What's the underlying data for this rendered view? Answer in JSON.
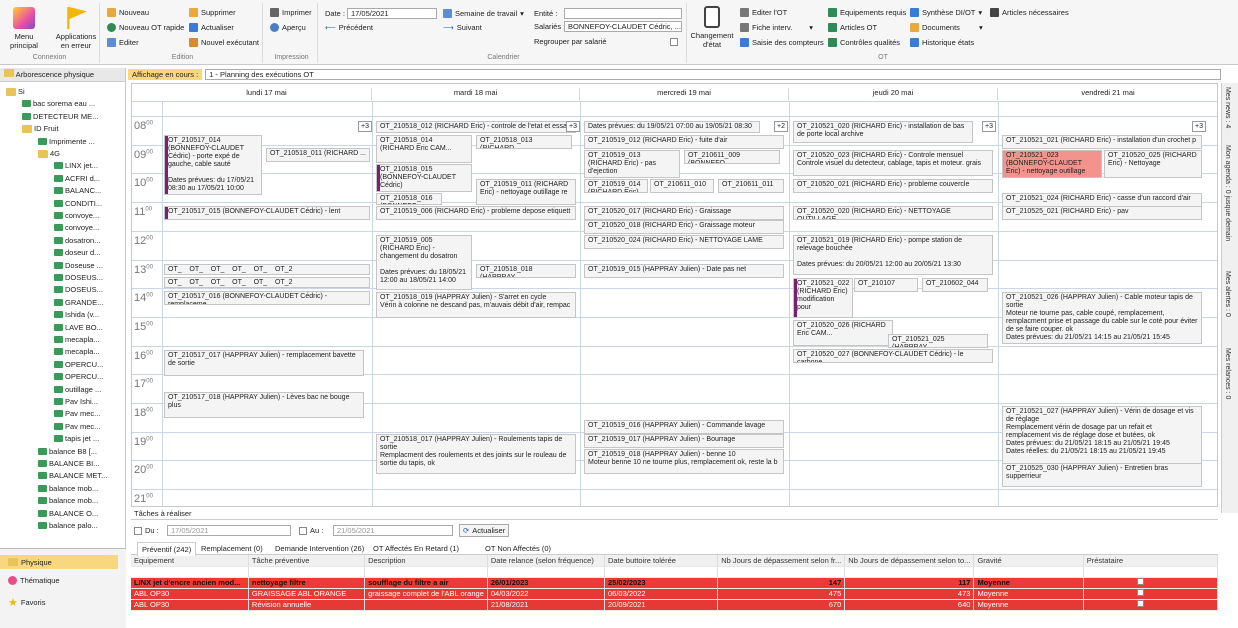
{
  "ribbon": {
    "menu_principal": "Menu principal",
    "applications_en_erreur": "Applications en erreur",
    "connexion": "Connexion",
    "nouveau": "Nouveau",
    "nouveau_ot_rapide": "Nouveau OT rapide",
    "editer": "Editer",
    "supprimer": "Supprimer",
    "actualiser": "Actualiser",
    "nouvel_executant": "Nouvel exécutant",
    "edition": "Edition",
    "imprimer": "Imprimer",
    "apercu": "Aperçu",
    "impression": "Impression",
    "date_label": "Date :",
    "date_value": "17/05/2021",
    "semaine_de_travail": "Semaine de travail",
    "precedent": "Précédent",
    "suivant": "Suivant",
    "entite_label": "Entité :",
    "salaries_label": "Salariés :",
    "salaries_value": "BONNEFOY-CLAUDET Cédric, ...",
    "regrouper": "Regrouper par salarié",
    "calendrier": "Calendrier",
    "changement_etat": "Changement d'état",
    "editer_ot": "Editer l'OT",
    "fiche_interv": "Fiche interv.",
    "saisie_compteurs": "Saisie des compteurs",
    "equipements_requis": "Equipements requis",
    "articles_ot": "Articles OT",
    "controles_qualites": "Contrôles qualités",
    "synthese": "Synthèse DI/OT",
    "documents": "Documents",
    "historique": "Historique états",
    "articles_necessaires": "Articles nécessaires",
    "ot": "OT"
  },
  "left": {
    "header": "Arborescence physique",
    "tree": [
      "Si",
      "bac sorema eau ...",
      "DETECTEUR ME...",
      "ID Fruit",
      "Imprimente ...",
      "4G",
      "LINX jet...",
      "ACFRI d...",
      "BALANC...",
      "CONDITI...",
      "convoye...",
      "convoye...",
      "dosatron...",
      "doseur d...",
      "Doseuse ...",
      "DOSEUS...",
      "DOSEUS...",
      "GRANDE...",
      "Ishida (v...",
      "LAVE BO...",
      "mecapla...",
      "mecapla...",
      "OPERCU...",
      "OPERCU...",
      "outillage ...",
      "Pav Ishi...",
      "Pav mec...",
      "Pav mec...",
      "tapis jet ...",
      "balance B8 [...",
      "BALANCE BI...",
      "BALANCE MET...",
      "balance mob...",
      "balance mob...",
      "BALANCE O...",
      "balance palo..."
    ],
    "nav": [
      "Physique",
      "Thématique",
      "Favoris"
    ]
  },
  "header_bar": {
    "affichage": "Affichage en cours :",
    "value": "1 - Planning des exécutions OT"
  },
  "days": [
    "lundi 17 mai",
    "mardi 18 mai",
    "mercredi 19 mai",
    "jeudi 20 mai",
    "vendredi 21 mai"
  ],
  "hours": [
    "08",
    "09",
    "10",
    "11",
    "12",
    "13",
    "14",
    "15",
    "16",
    "17",
    "18",
    "19",
    "20",
    "21"
  ],
  "more": "+3",
  "more2": "+2",
  "events": {
    "e1": "OT_210517_014 (BONNEFOY-CLAUDET Cédric) - porte expé de gauche, cable sauté\n\nDates prévues: du 17/05/21 08:30 au 17/05/21 10:00",
    "e2": "OT_210518_011 (RICHARD ...",
    "e3": "OT_210517_015 (BONNEFOY-CLAUDET Cédric) - lent",
    "e4": "OT_    OT_    OT_    OT_    OT_    OT_2",
    "e5": "OT_    OT_    OT_    OT_    OT_    OT_2",
    "e6": "OT_210517_016 (BONNEFOY-CLAUDET Cédric) - remplaceme",
    "e7": "OT_210517_017 (HAPPRAY Julien) - remplacement bavette de sortie",
    "e8": "OT_210517_018 (HAPPRAY Julien) - Lèves bac ne bouge plus",
    "m1": "OT_210518_012 (RICHARD Eric) - controle de l'etat et essa",
    "m2": "OT_210518_014 (RICHARD Eric CAM...",
    "m3": "OT_210518_013 (RICHARD...",
    "m4": "OT_210518_015 (BONNEFOY-CLAUDET Cédric)",
    "m5": "OT_210518_016 (BONNEFO...",
    "m6": "OT_210519_011 (RICHARD Eric) - nettoyage outillage re",
    "m7": "OT_210519_006 (RICHARD Eric) - probleme depose etiquett",
    "m8": "OT_210519_005 (RICHARD Eric) - changement du dosatron\n\nDates prévues: du 18/05/21 12:00 au 18/05/21 14:00",
    "m9": "OT_210518_018 (HAPPRAY...",
    "m10": "OT_210518_019 (HAPPRAY Julien) - S'arret en cycle\nVérin à colonne ne descand pas, m'auvais débit d'air, rempac",
    "m11": "OT_210518_017 (HAPPRAY Julien) - Roulements tapis de sortie\nRemplacment des roulements et des joints sur le rouleau de sortie du tapis, ok",
    "w0": "Dates prévues: du 19/05/21 07:00 au 19/05/21 08:30",
    "w1": "OT_210519_012 (RICHARD Eric) - fuite d'air",
    "w2": "OT_210519_013 (RICHARD Eric) - pas d'ejection",
    "w3": "OT_210611_009 (BONNEFO...",
    "w4": "OT_210519_014 (RICHARD Eric) ...",
    "w5": "OT_210611_010",
    "w6": "OT_210611_011",
    "w7": "OT_210520_017 (RICHARD Eric) - Graissage",
    "w8": "OT_210520_018 (RICHARD Eric) - Graissage moteur",
    "w9": "OT_210520_024 (RICHARD Eric) - NETTOYAGE LAME",
    "w10": "OT_210519_015 (HAPPRAY Julien) - Date pas net",
    "w11": "OT_210519_016 (HAPPRAY Julien) - Commande lavage",
    "w12": "OT_210519_017 (HAPPRAY Julien) - Bourrage",
    "w13": "OT_210519_018 (HAPPRAY Julien) - benne 10\nMoteur benne 10 ne tourne plus, remplacement ok, reste la b",
    "j1": "OT_210521_020 (RICHARD Eric) - installation de bas de porte local archive",
    "j2": "OT_210520_023 (RICHARD Eric) - Controle mensuel\nControle visuel du detecteur, cablage, tapis et moteur. grais",
    "j3": "OT_210520_021 (RICHARD Eric) - probleme couvercle",
    "j4": "OT_210520_020 (RICHARD Eric) - NETTOYAGE OUTILLAGE",
    "j5": "OT_210521_019 (RICHARD Eric) - pompe station de relevage bouchée\n\nDates prévues: du 20/05/21 12:00 au 20/05/21 13:30",
    "j6": "OT_210521_022 (RICHARD Eric) modification pour",
    "j7": "OT_210107",
    "j8": "OT_210602_044",
    "j9": "OT_210520_026 (RICHARD Eric CAM...",
    "j10": "OT_210521_025 (HAPPRAY...",
    "j11": "OT_210520_027 (BONNEFOY-CLAUDET Cédric) - le carbone",
    "v1": "OT_210521_021 (RICHARD Eric) - installation d'un crochet p",
    "v2": "OT_210521_023 (BONNEFOY-CLAUDET Eric) - nettoyage outillage",
    "v3": "OT_210520_025 (RICHARD Eric) - Nettoyage",
    "v4": "OT_210521_024 (RICHARD Eric) - casse d'un raccord d'air",
    "v5": "OT_210525_021 (RICHARD Eric) - pav",
    "v6": "OT_210521_026 (HAPPRAY Julien) - Cable moteur tapis de sortie\nMoteur ne tourne pas, cable coupé, remplacement, remplacment prise et passage du cable sur le coté pour éviter de se faire couper. ok\nDates prévues: du 21/05/21 14:15 au 21/05/21 15:45",
    "v7": "OT_210521_027 (HAPPRAY Julien) - Vérin de dosage et vis de réglage\nRemplacement vérin de dosage par un refait et remplacement vis de réglage dose et butées, ok\nDates prévues: du 21/05/21 18:15 au 21/05/21 19:45\nDates réelles: du 21/05/21 18:15 au 21/05/21 19:45",
    "v8": "OT_210525_030 (HAPPRAY Julien) - Entretien bras supperrieur"
  },
  "right_tabs": [
    "Mes news : 4",
    "Mon agenda : 0 jusque demain",
    "Mes alertes : 0",
    "Mes relances : 0"
  ],
  "tasks": {
    "title": "Tâches à réaliser",
    "du_label": "Du :",
    "du_value": "17/05/2021",
    "au_label": "Au :",
    "au_value": "21/05/2021",
    "actualiser": "Actualiser",
    "tabs": [
      "Préventif (242)",
      "Remplacement (0)",
      "Demande Intervention (26)",
      "OT Affectés En Retard (1)",
      "OT Non Affectés (0)"
    ],
    "columns": [
      "Equipement",
      "Tâche préventive",
      "Description",
      "Date relance (selon fréquence)",
      "Date buttoire tolérée",
      "Nb Jours de dépassement selon fr...",
      "Nb Jours de dépassement selon to...",
      "Gravité",
      "Préstataire"
    ],
    "rows": [
      [
        "LINX jet d'encre ancien mod...",
        "nettoyage filtre",
        "soufflage du filtre a air",
        "26/01/2023",
        "25/02/2023",
        "147",
        "117",
        "Moyenne",
        ""
      ],
      [
        "ABL OP30",
        "GRAISSAGE ABL ORANGE",
        "graissage complet de l'ABL orange",
        "04/03/2022",
        "06/03/2022",
        "475",
        "473",
        "Moyenne",
        ""
      ],
      [
        "ABL OP30",
        "Révision annuelle",
        "",
        "21/08/2021",
        "20/09/2021",
        "670",
        "640",
        "Moyenne",
        ""
      ]
    ]
  }
}
